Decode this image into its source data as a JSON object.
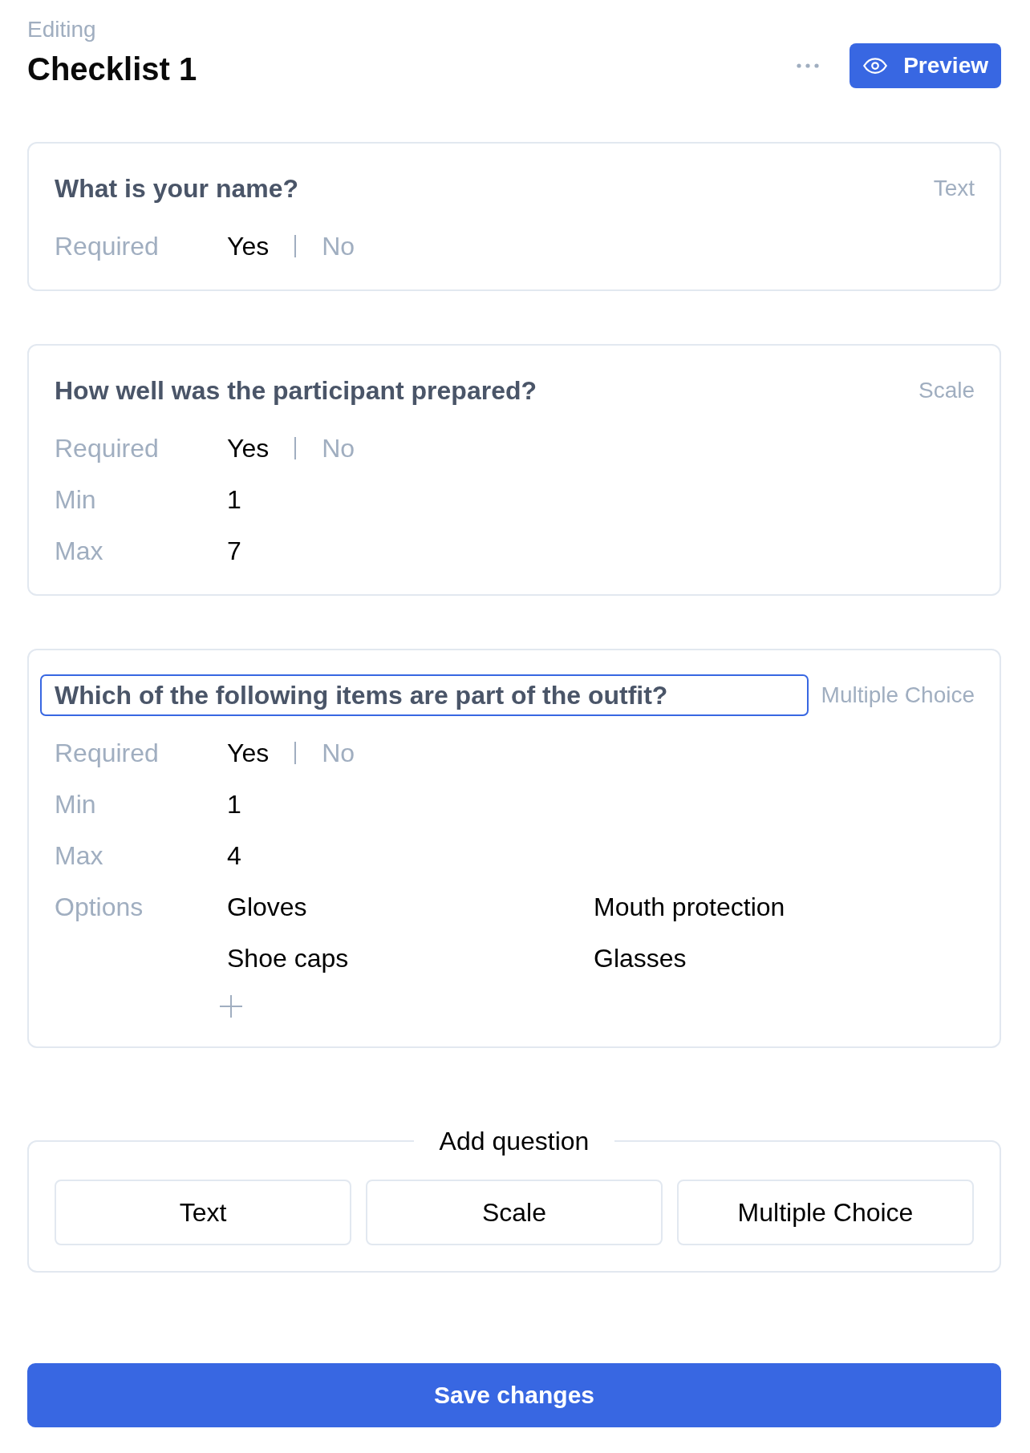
{
  "header": {
    "subtitle": "Editing",
    "title": "Checklist 1",
    "preview_button": "Preview"
  },
  "questions": [
    {
      "title": "What is your name?",
      "type_label": "Text",
      "editing": false,
      "rows": [
        {
          "kind": "toggle",
          "label": "Required",
          "options": [
            {
              "label": "Yes",
              "selected": true
            },
            {
              "label": "No",
              "selected": false
            }
          ]
        }
      ]
    },
    {
      "title": "How well was the participant prepared?",
      "type_label": "Scale",
      "editing": false,
      "rows": [
        {
          "kind": "toggle",
          "label": "Required",
          "options": [
            {
              "label": "Yes",
              "selected": true
            },
            {
              "label": "No",
              "selected": false
            }
          ]
        },
        {
          "kind": "value",
          "label": "Min",
          "value": "1"
        },
        {
          "kind": "value",
          "label": "Max",
          "value": "7"
        }
      ]
    },
    {
      "title": "Which of the following items are part of the outfit?",
      "type_label": "Multiple Choice",
      "editing": true,
      "rows": [
        {
          "kind": "toggle",
          "label": "Required",
          "options": [
            {
              "label": "Yes",
              "selected": true
            },
            {
              "label": "No",
              "selected": false
            }
          ]
        },
        {
          "kind": "value",
          "label": "Min",
          "value": "1"
        },
        {
          "kind": "value",
          "label": "Max",
          "value": "4"
        },
        {
          "kind": "options",
          "label": "Options",
          "options": [
            "Gloves",
            "Mouth protection",
            "Shoe caps",
            "Glasses"
          ]
        }
      ]
    }
  ],
  "add_question": {
    "legend": "Add question",
    "buttons": [
      "Text",
      "Scale",
      "Multiple Choice"
    ]
  },
  "save_button": "Save changes"
}
